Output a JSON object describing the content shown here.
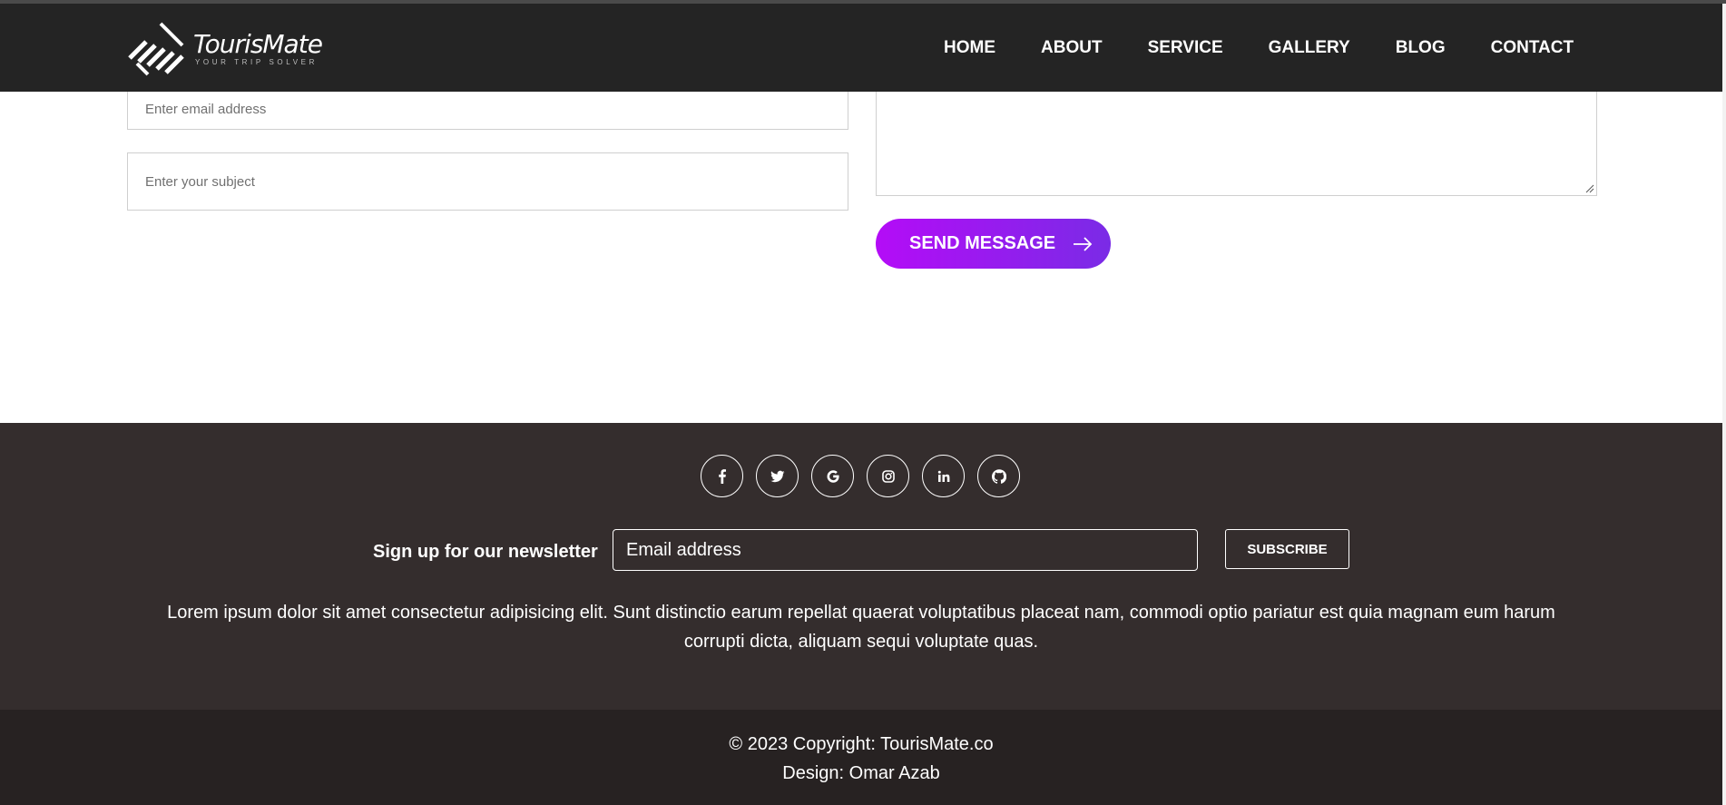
{
  "navbar": {
    "logo": {
      "name": "TourisMate",
      "tagline": "YOUR TRIP SOLVER"
    },
    "items": [
      {
        "label": "HOME"
      },
      {
        "label": "ABOUT"
      },
      {
        "label": "SERVICE"
      },
      {
        "label": "GALLERY"
      },
      {
        "label": "BLOG"
      },
      {
        "label": "CONTACT"
      }
    ]
  },
  "contact_form": {
    "email_placeholder": "Enter email address",
    "subject_placeholder": "Enter your subject",
    "send_label": "SEND MESSAGE",
    "accent_start": "#b40cf7",
    "accent_end": "#7a2be6"
  },
  "footer": {
    "social_icons": [
      "facebook-icon",
      "twitter-icon",
      "google-icon",
      "instagram-icon",
      "linkedin-icon",
      "github-icon"
    ],
    "newsletter_label": "Sign up for our newsletter",
    "newsletter_placeholder": "Email address",
    "subscribe_label": "SUBSCRIBE",
    "description": "Lorem ipsum dolor sit amet consectetur adipisicing elit. Sunt distinctio earum repellat quaerat voluptatibus placeat nam, commodi optio pariatur est quia magnam eum harum corrupti dicta, aliquam sequi voluptate quas.",
    "copyright": "© 2023 Copyright: TourisMate.co",
    "design_credit": "Design: Omar Azab",
    "background": "#342d2d",
    "bottom_background": "#272222"
  }
}
